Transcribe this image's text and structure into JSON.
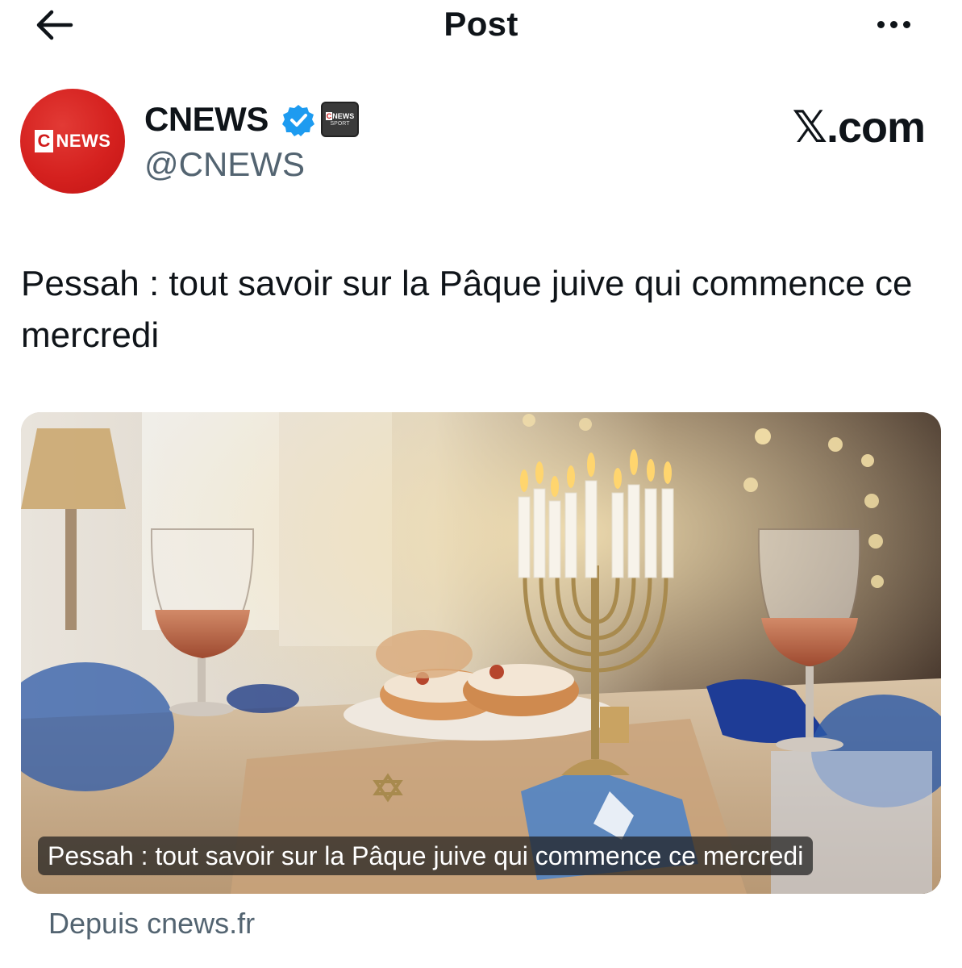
{
  "header": {
    "title": "Post",
    "back_icon": "arrow-left-icon",
    "more_icon": "more-horizontal-icon"
  },
  "author": {
    "avatar_text_c": "C",
    "avatar_text_news": "NEWS",
    "name": "CNEWS",
    "handle": "@CNEWS",
    "verified_icon": "verified-badge-icon",
    "affiliate_badge_line1_c": "C",
    "affiliate_badge_line1_news": "NEWS",
    "affiliate_badge_line2": "SPORT",
    "accent_color": "#1d9bf0",
    "brand_color": "#d5211f"
  },
  "watermark": "𝕏.com",
  "post": {
    "text": "Pessah : tout savoir sur la Pâque juive qui commence ce mercredi"
  },
  "link_card": {
    "image_subject": "menorah-table-scene",
    "caption": "Pessah : tout savoir sur la Pâque juive qui commence ce mercredi",
    "source": "Depuis cnews.fr"
  }
}
